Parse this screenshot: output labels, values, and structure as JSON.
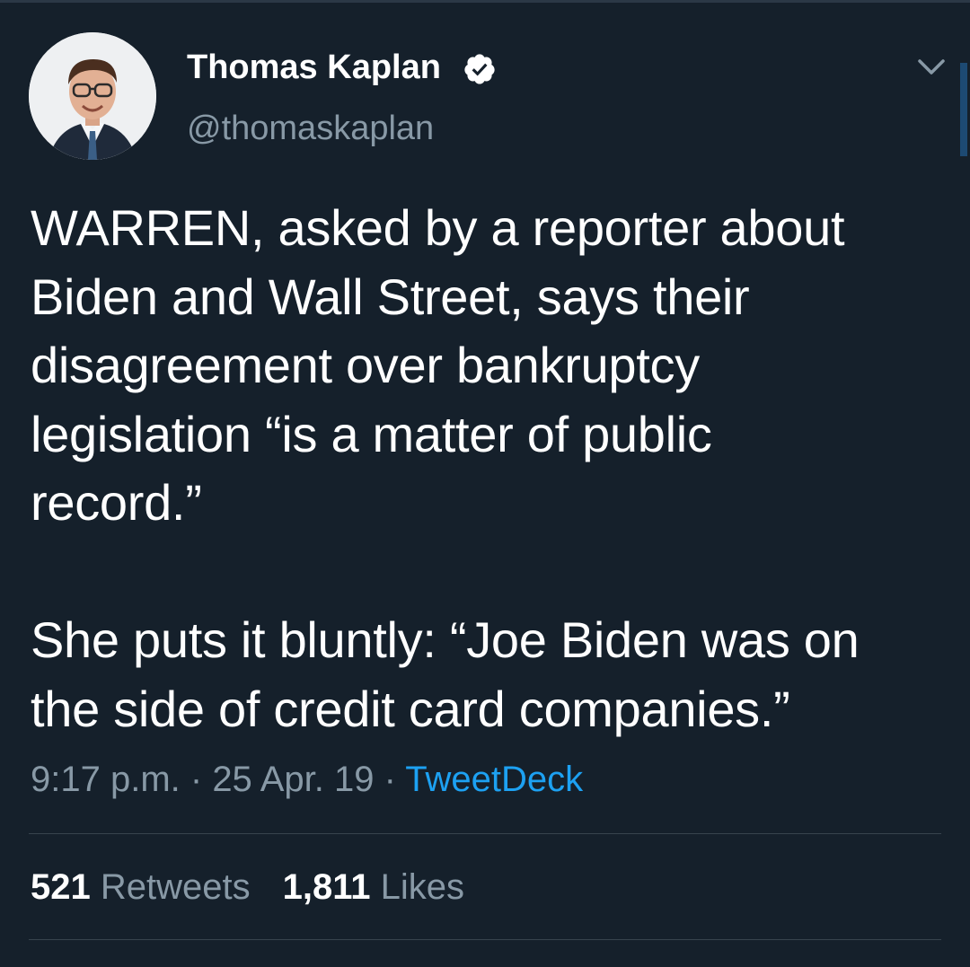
{
  "tweet": {
    "author": {
      "display_name": "Thomas Kaplan",
      "handle": "@thomaskaplan",
      "verified": true
    },
    "text": "WARREN, asked by a reporter about\nBiden and Wall Street, says their\ndisagreement over bankruptcy\nlegislation “is a matter of public\nrecord.”\n\nShe puts it bluntly: “Joe Biden was on\nthe side of credit card companies.”",
    "time": "9:17 p.m.",
    "separator": " · ",
    "date": "25 Apr. 19",
    "source": "TweetDeck",
    "retweets": {
      "count": "521",
      "label": "Retweets"
    },
    "likes": {
      "count": "1,811",
      "label": "Likes"
    }
  },
  "icons": {
    "verified": "verified-badge-icon",
    "menu": "chevron-down-icon"
  },
  "colors": {
    "background": "#15202b",
    "secondary_text": "#8899a6",
    "link": "#1da1f2",
    "divider": "#38444d"
  }
}
